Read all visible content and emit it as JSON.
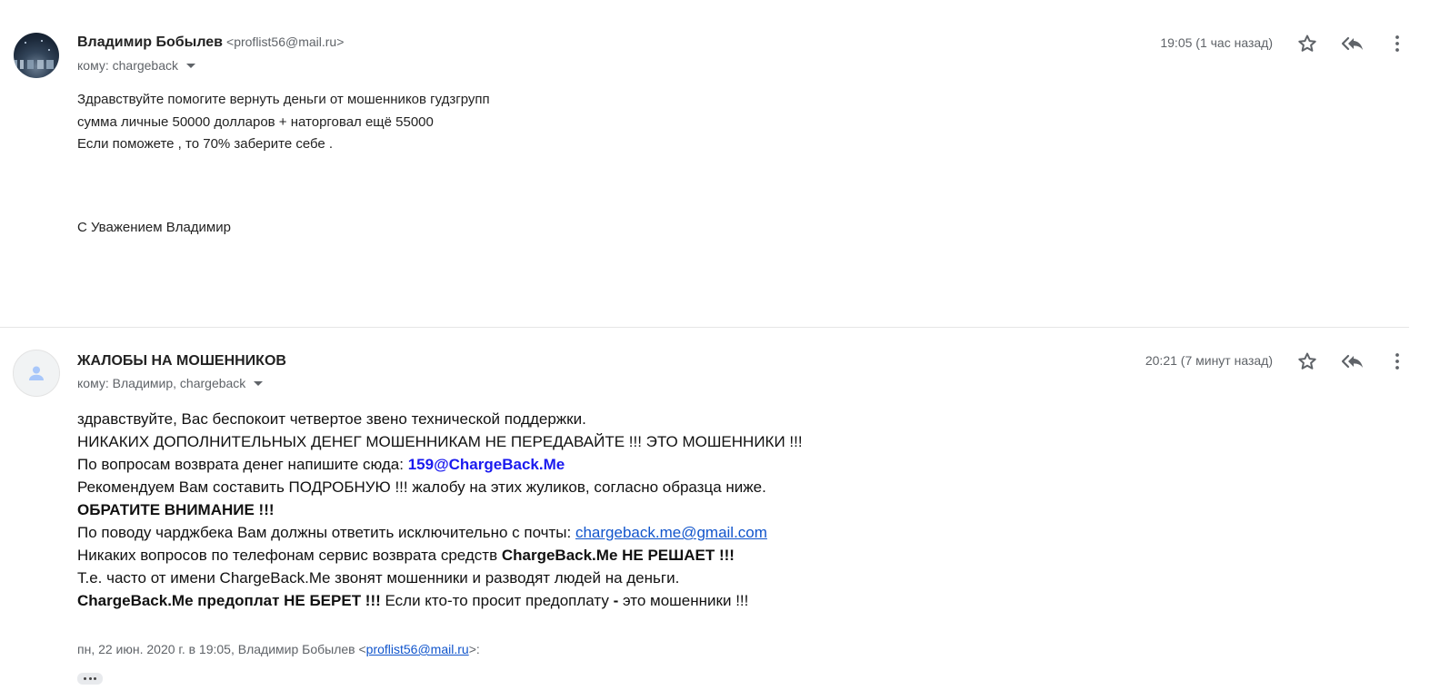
{
  "messages": [
    {
      "sender_name": "Владимир Бобылев",
      "sender_email": "<proflist56@mail.ru>",
      "to": "кому: chargeback",
      "time": "19:05 (1 час назад)",
      "body_lines": [
        "Здравствуйте помогите вернуть деньги от мошенников гудзгрупп",
        "сумма личные 50000 долларов + наторговал ещё 55000",
        "Если поможете , то 70% заберите себе ."
      ],
      "signature": "С Уважением Владимир",
      "icons": [
        "avatar-photo",
        "star-icon",
        "reply-all-icon",
        "more-vert-icon"
      ]
    },
    {
      "sender_name": "ЖАЛОБЫ НА МОШЕННИКОВ",
      "to": "кому: Владимир, chargeback",
      "time": "20:21 (7 минут назад)",
      "body": {
        "line1": "здравствуйте, Вас беспокоит четвертое звено технической поддержки.",
        "line2": "НИКАКИХ ДОПОЛНИТЕЛЬНЫХ ДЕНЕГ МОШЕННИКАМ НЕ ПЕРЕДАВАЙТЕ !!! ЭТО МОШЕННИКИ !!!",
        "line3_text": "По вопросам возврата денег напишите сюда: ",
        "line3_email": "159@ChargeBack.Me",
        "line4": "Рекомендуем Вам составить ПОДРОБНУЮ !!! жалобу на этих жуликов, согласно образца ниже.",
        "line5": "ОБРАТИТЕ ВНИМАНИЕ !!!",
        "line6_text": "По поводу чарджбека Вам должны ответить исключительно с почты: ",
        "line6_link": "chargeback.me@gmail.com",
        "line7_text": "Никаких вопросов по телефонам сервис возврата средств ",
        "line7_bold": "ChargeBack.Me НЕ РЕШАЕТ !!!",
        "line8": "Т.е. часто от имени ChargeBack.Me звонят мошенники и разводят людей на деньги.",
        "line9_bold": "ChargeBack.Me предоплат НЕ БЕРЕТ !!!",
        "line9_text": " Если кто-то просит предоплату ",
        "line9_dash": "-",
        "line9_end": " это мошенники !!!"
      },
      "quote": {
        "prefix": "пн, 22 июн. 2020 г. в 19:05, Владимир Бобылев <",
        "email": "proflist56@mail.ru",
        "suffix": ">:"
      },
      "icons": [
        "person-icon",
        "star-icon",
        "reply-all-icon",
        "more-vert-icon",
        "ellipsis-icon"
      ]
    }
  ]
}
